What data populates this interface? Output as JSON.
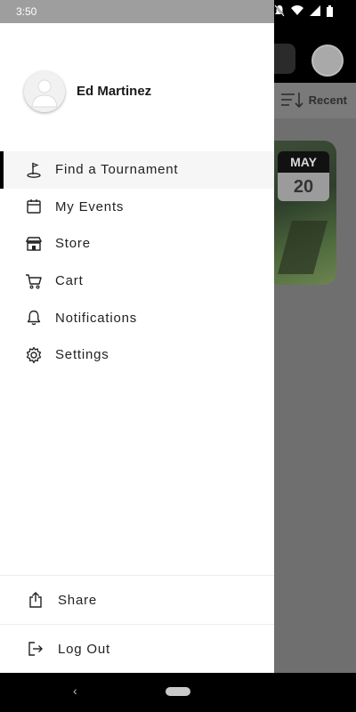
{
  "status_bar": {
    "time": "3:50"
  },
  "background": {
    "sort_label": "Recent",
    "date_badge": {
      "month": "MAY",
      "day": "20"
    }
  },
  "drawer": {
    "user": {
      "name": "Ed Martinez"
    },
    "menu": [
      {
        "label": "Find a Tournament",
        "icon": "golf-flag-icon",
        "active": true
      },
      {
        "label": "My Events",
        "icon": "calendar-icon",
        "active": false
      },
      {
        "label": "Store",
        "icon": "store-icon",
        "active": false
      },
      {
        "label": "Cart",
        "icon": "cart-icon",
        "active": false
      },
      {
        "label": "Notifications",
        "icon": "bell-icon",
        "active": false
      },
      {
        "label": "Settings",
        "icon": "gear-icon",
        "active": false
      }
    ],
    "footer": [
      {
        "label": "Share",
        "icon": "share-icon"
      },
      {
        "label": "Log Out",
        "icon": "logout-icon"
      }
    ]
  },
  "colors": {
    "active_indicator": "#000000",
    "scrim": "#6f6f6f"
  }
}
